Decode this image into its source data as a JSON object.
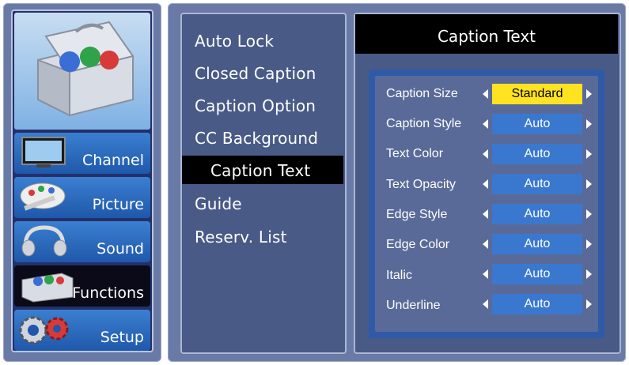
{
  "nav": {
    "items": [
      {
        "label": "Channel",
        "icon": "tv-icon"
      },
      {
        "label": "Picture",
        "icon": "palette-icon"
      },
      {
        "label": "Sound",
        "icon": "headphones-icon"
      },
      {
        "label": "Functions",
        "icon": "toolbox-icon"
      },
      {
        "label": "Setup",
        "icon": "gears-icon"
      }
    ],
    "active": "Functions",
    "hero_icon": "toolbox-icon"
  },
  "menu": {
    "items": [
      "Auto Lock",
      "Closed Caption",
      "Caption Option",
      "CC Background",
      "Caption Text",
      "Guide",
      "Reserv. List"
    ],
    "selected": "Caption Text"
  },
  "detail": {
    "title": "Caption Text",
    "rows": [
      {
        "label": "Caption Size",
        "value": "Standard"
      },
      {
        "label": "Caption Style",
        "value": "Auto"
      },
      {
        "label": "Text Color",
        "value": "Auto"
      },
      {
        "label": "Text Opacity",
        "value": "Auto"
      },
      {
        "label": "Edge Style",
        "value": "Auto"
      },
      {
        "label": "Edge Color",
        "value": "Auto"
      },
      {
        "label": "Italic",
        "value": "Auto"
      },
      {
        "label": "Underline",
        "value": "Auto"
      }
    ],
    "selected_row": "Caption Size"
  },
  "colors": {
    "frame": "#6a7aa6",
    "highlight": "#000000",
    "value_box": "#3a78d0",
    "value_selected": "#ffe320",
    "nav_button": "#2a66bb"
  }
}
